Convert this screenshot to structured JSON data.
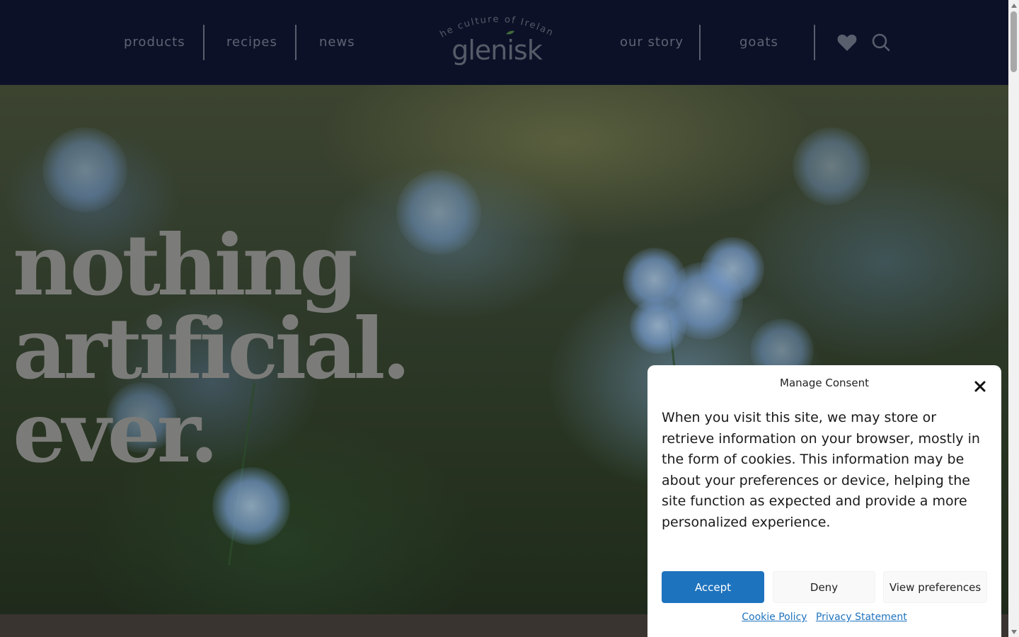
{
  "header": {
    "nav_left": [
      {
        "label": "products"
      },
      {
        "label": "recipes"
      },
      {
        "label": "news"
      }
    ],
    "nav_right": [
      {
        "label": "our story"
      },
      {
        "label": "goats"
      }
    ],
    "logo": {
      "tagline": "the culture of Ireland",
      "wordmark": "glenisk"
    },
    "icons": [
      "heart-icon",
      "search-icon"
    ]
  },
  "hero": {
    "title_lines": [
      "nothing",
      "artificial.",
      "ever."
    ]
  },
  "consent": {
    "title": "Manage Consent",
    "body": "When you visit this site, we may store or retrieve information on your browser, mostly in the form of cookies. This information may be about your preferences or device, helping the site function as expected and provide a more personalized experience.",
    "buttons": {
      "accept": "Accept",
      "deny": "Deny",
      "preferences": "View preferences"
    },
    "links": {
      "cookie_policy": "Cookie Policy",
      "privacy_statement": "Privacy Statement"
    }
  },
  "colors": {
    "header_bg": "#0d1128",
    "nav_text": "#5f6474",
    "accent_button": "#1e73be",
    "hero_text": "#7b7c79"
  }
}
